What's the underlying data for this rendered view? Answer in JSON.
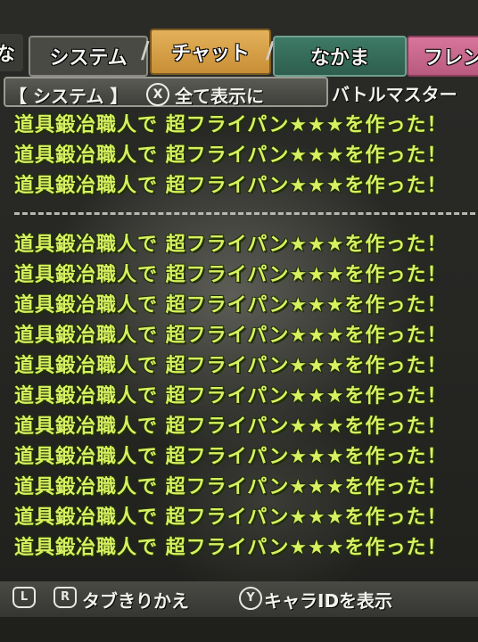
{
  "tabs": {
    "partial_left": "な",
    "system": "システム",
    "chat": "チャット",
    "party": "なかま",
    "friend": "フレン"
  },
  "header": {
    "filter_label": "【 システム 】",
    "x_button": "X",
    "show_all": "全て表示に",
    "right_label": "バトルマスター"
  },
  "log": {
    "top_lines": [
      "道具鍛冶職人で 超フライパン★★★を作った！",
      "道具鍛冶職人で 超フライパン★★★を作った！",
      "道具鍛冶職人で 超フライパン★★★を作った！"
    ],
    "bottom_lines": [
      "道具鍛冶職人で 超フライパン★★★を作った！",
      "道具鍛冶職人で 超フライパン★★★を作った！",
      "道具鍛冶職人で 超フライパン★★★を作った！",
      "道具鍛冶職人で 超フライパン★★★を作った！",
      "道具鍛冶職人で 超フライパン★★★を作った！",
      "道具鍛冶職人で 超フライパン★★★を作った！",
      "道具鍛冶職人で 超フライパン★★★を作った！",
      "道具鍛冶職人で 超フライパン★★★を作った！",
      "道具鍛冶職人で 超フライパン★★★を作った！",
      "道具鍛冶職人で 超フライパン★★★を作った！",
      "道具鍛冶職人で 超フライパン★★★を作った！"
    ]
  },
  "footer": {
    "l_button": "L",
    "r_button": "R",
    "switch_tab": "タブきりかえ",
    "y_button": "Y",
    "show_id": "キャラIDを表示"
  },
  "colors": {
    "log_text": "#d8f060",
    "chat_tab": "#e3b15a",
    "party_tab": "#3d7a65",
    "friend_tab": "#d8759b"
  }
}
